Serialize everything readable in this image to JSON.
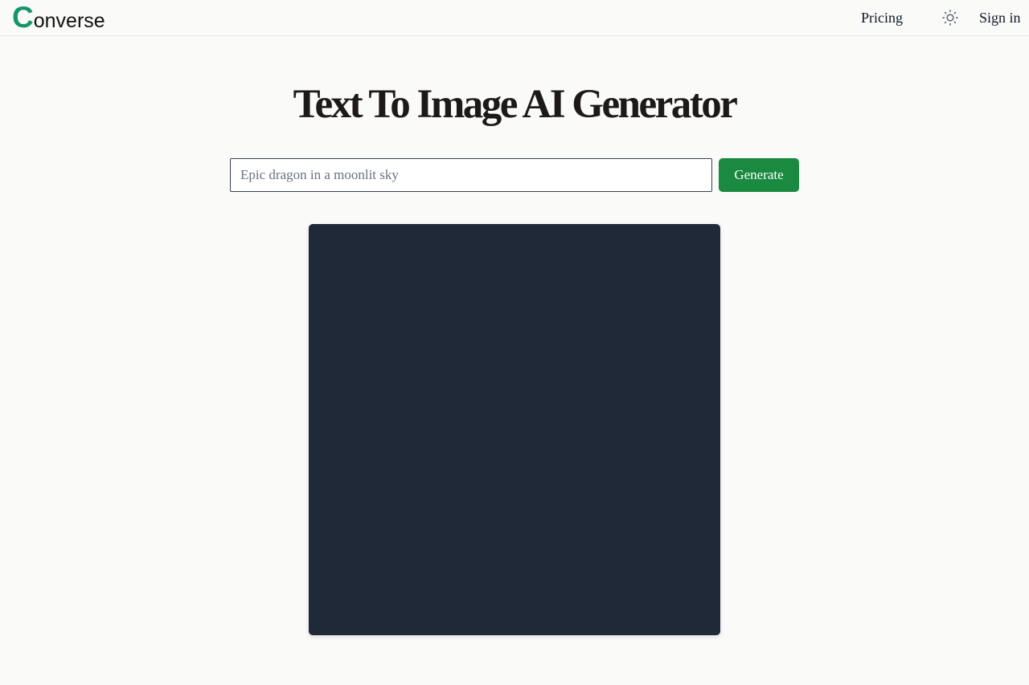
{
  "brand": {
    "initial": "C",
    "rest": "onverse",
    "initial_color": "#16956a"
  },
  "nav": {
    "pricing_label": "Pricing",
    "theme_icon": "sun-icon",
    "signin_label": "Sign in"
  },
  "main": {
    "title": "Text To Image AI Generator",
    "prompt_placeholder": "Epic dragon in a moonlit sky",
    "prompt_value": "",
    "generate_label": "Generate"
  },
  "colors": {
    "accent": "#198a3f",
    "canvas_bg": "#202938",
    "page_bg": "#fafaf9"
  }
}
